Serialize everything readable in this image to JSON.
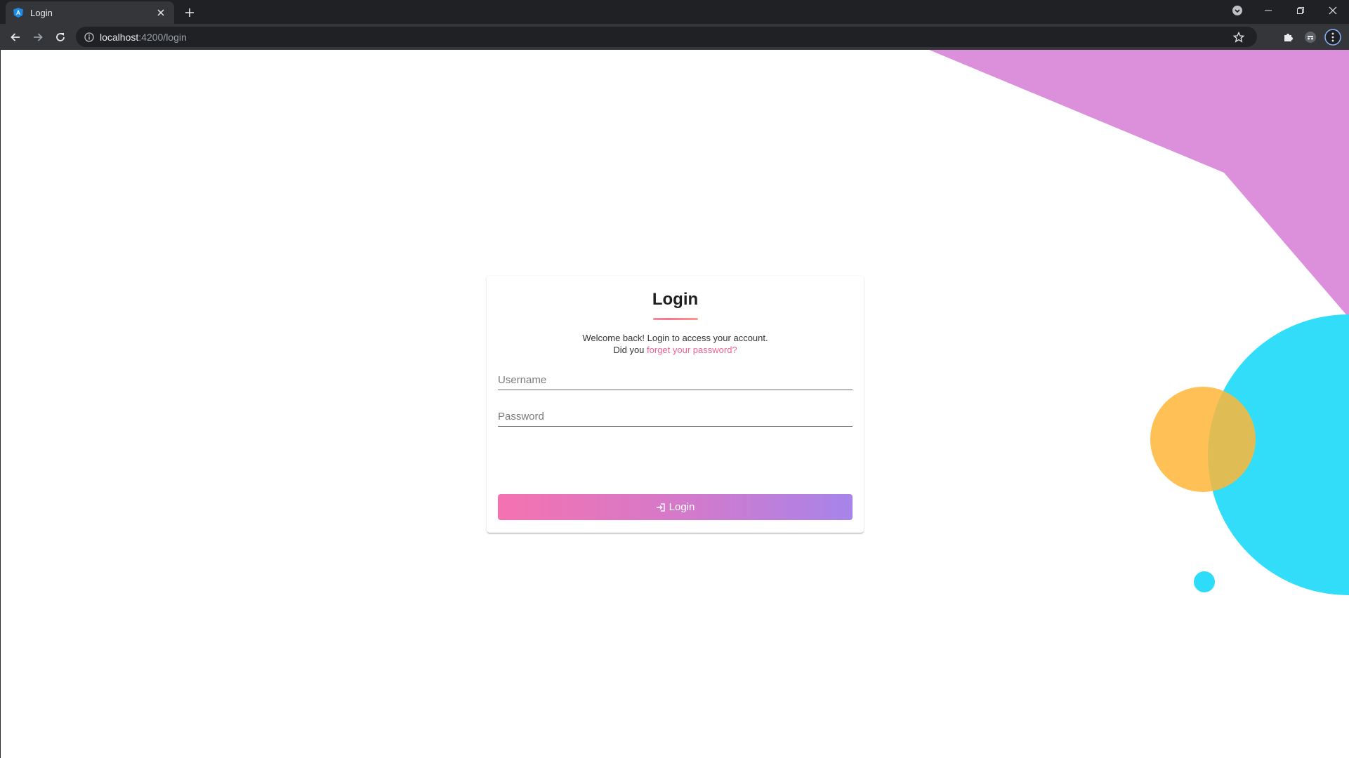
{
  "browser": {
    "tab_title": "Login",
    "url_host": "localhost",
    "url_rest": ":4200/login",
    "icons": [
      "angular-favicon",
      "close-icon",
      "plus-icon",
      "tab-search-icon",
      "minimize-icon",
      "restore-icon",
      "window-close-icon",
      "back-icon",
      "forward-icon",
      "reload-icon",
      "info-icon",
      "star-icon",
      "extensions-icon",
      "incognito-icon",
      "menu-icon"
    ]
  },
  "login": {
    "title": "Login",
    "welcome_line1": "Welcome back! Login to access your account.",
    "welcome_prefix": "Did you ",
    "forgot_link": "forget your password?",
    "username_placeholder": "Username",
    "password_placeholder": "Password",
    "button_label": "Login",
    "button_icon": "login-icon"
  },
  "colors": {
    "accent_pink": "#f06292",
    "button_gradient_start": "#f472b0",
    "button_gradient_end": "#a784ea",
    "deco_purple": "#dc90dc",
    "deco_cyan": "#2ddcf8",
    "deco_orange": "#ffbf52"
  }
}
